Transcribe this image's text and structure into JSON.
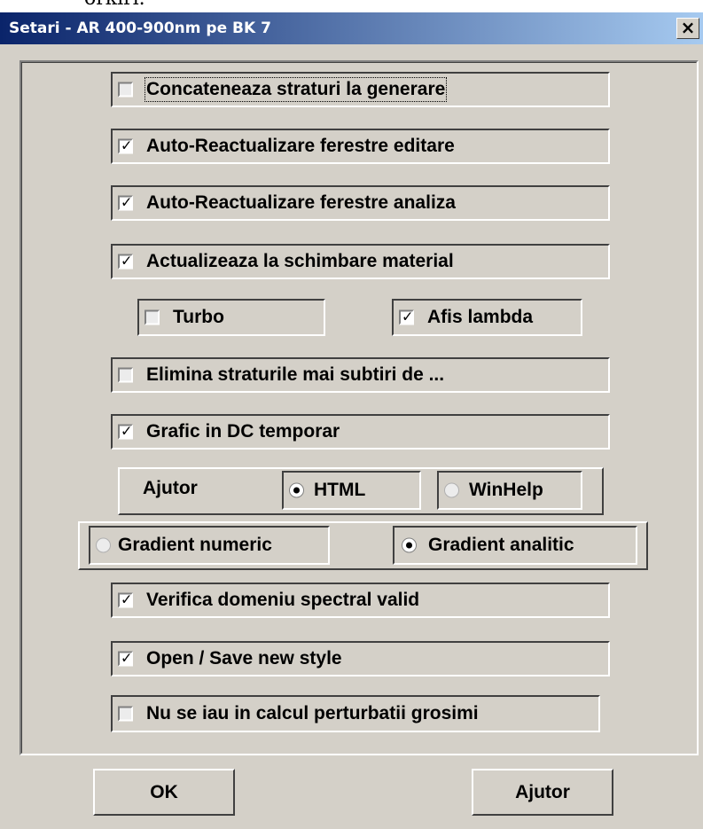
{
  "clipped_text": "orkiri.",
  "window": {
    "title": "Setari - AR 400-900nm pe BK 7",
    "close_glyph": "×"
  },
  "options": [
    {
      "label": "Concateneaza straturi la generare",
      "checked": false
    },
    {
      "label": "Auto-Reactualizare ferestre editare",
      "checked": true
    },
    {
      "label": "Auto-Reactualizare ferestre analiza",
      "checked": true
    },
    {
      "label": "Actualizeaza la schimbare material",
      "checked": true
    },
    {
      "label": "Turbo",
      "checked": false
    },
    {
      "label": "Afis lambda",
      "checked": true
    },
    {
      "label": "Elimina straturile mai subtiri de ...",
      "checked": false
    },
    {
      "label": "Grafic in DC temporar",
      "checked": true
    },
    {
      "label": "Verifica domeniu spectral valid",
      "checked": true
    },
    {
      "label": "Open / Save new style",
      "checked": true
    },
    {
      "label": "Nu se iau in calcul perturbatii grosimi",
      "checked": false
    }
  ],
  "help_group": {
    "label": "Ajutor",
    "html_label": "HTML",
    "winhelp_label": "WinHelp",
    "selected": "HTML"
  },
  "gradient_group": {
    "numeric_label": "Gradient numeric",
    "analitic_label": "Gradient analitic",
    "selected": "Gradient analitic"
  },
  "buttons": {
    "ok": "OK",
    "help": "Ajutor"
  },
  "colors": {
    "title_start": "#0a246a",
    "title_end": "#a6caf0",
    "face": "#d4d0c8"
  }
}
